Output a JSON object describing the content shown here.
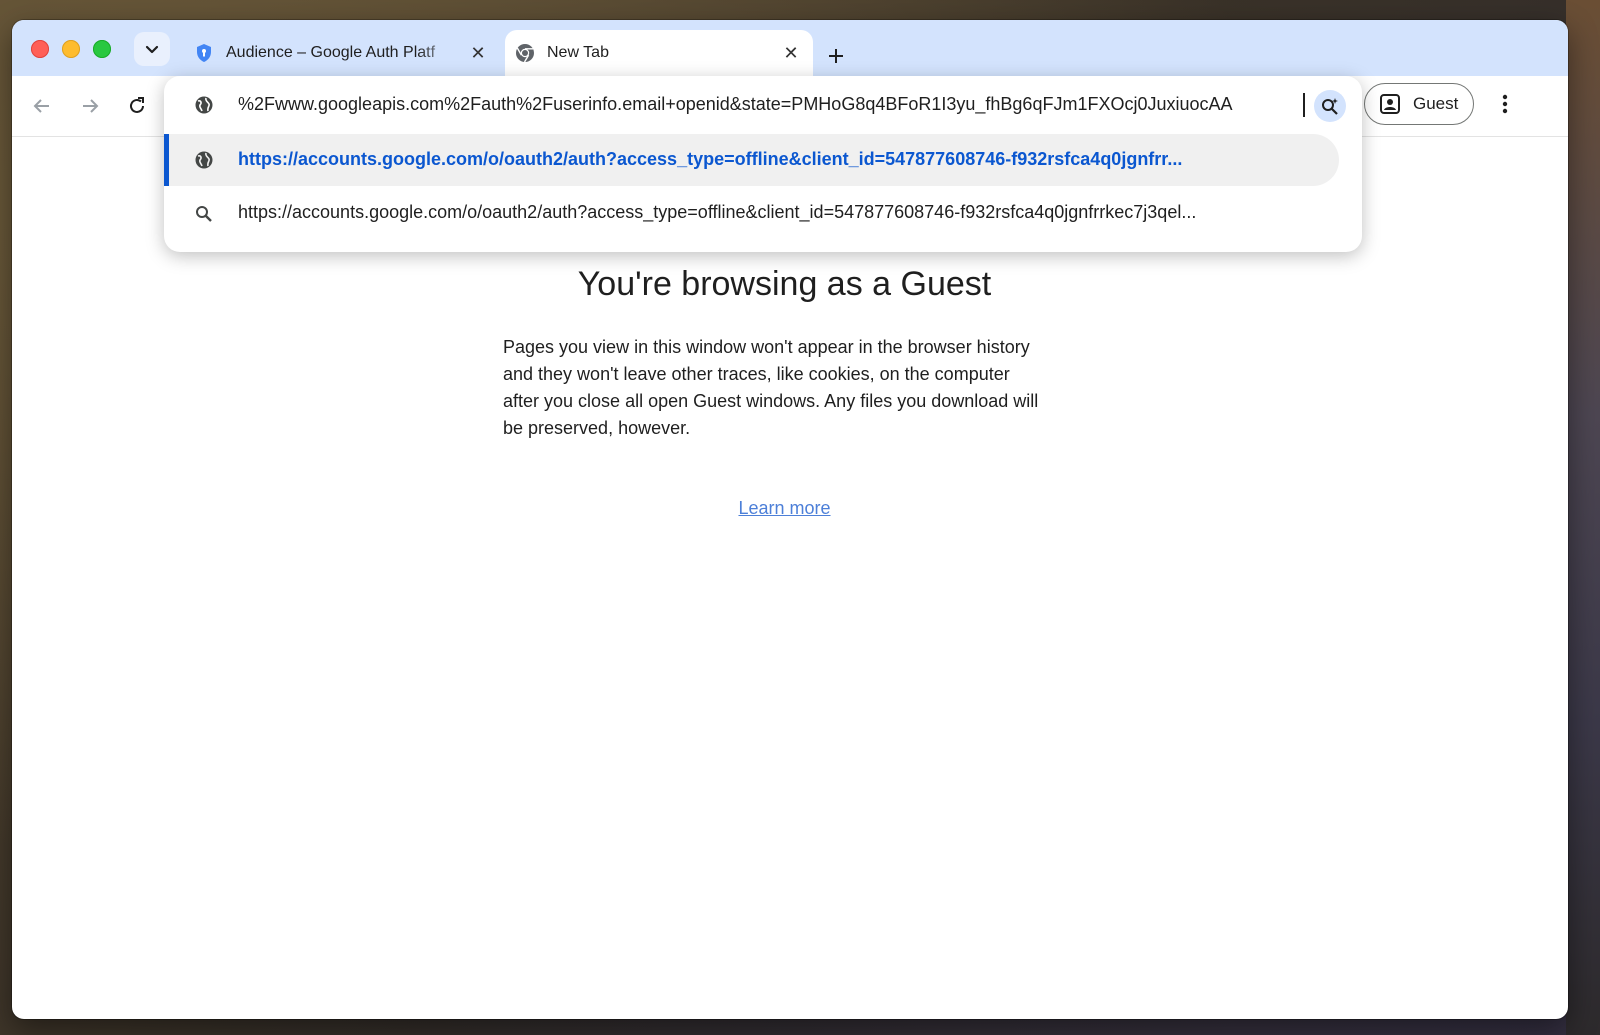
{
  "browser": {
    "tabs": [
      {
        "label": "Audience – Google Auth Platf",
        "active": false,
        "icon": "shield-icon"
      },
      {
        "label": "New Tab",
        "active": true,
        "icon": "chrome-icon"
      }
    ],
    "profile_button_label": "Guest"
  },
  "omnibox": {
    "input_value": "%2Fwww.googleapis.com%2Fauth%2Fuserinfo.email+openid&state=PMHoG8q4BFoR1I3yu_fhBg6qFJm1FXOcj0JuxiuocAA",
    "suggestions": [
      {
        "text": "https://accounts.google.com/o/oauth2/auth?access_type=offline&client_id=547877608746-f932rsfca4q0jgnfrr...",
        "type": "url",
        "icon": "globe-icon",
        "selected": true
      },
      {
        "text": "https://accounts.google.com/o/oauth2/auth?access_type=offline&client_id=547877608746-f932rsfca4q0jgnfrrkec7j3qel...",
        "type": "search",
        "icon": "search-icon",
        "selected": false
      }
    ]
  },
  "page": {
    "heading": "You're browsing as a Guest",
    "body": "Pages you view in this window won't appear in the browser history and they won't leave other traces, like cookies, on the computer after you close all open Guest windows. Any files you download will be preserved, however.",
    "learn_more": "Learn more"
  },
  "colors": {
    "tabstrip": "#d3e3fd",
    "accent": "#0b57d0",
    "link": "#4c7fd8"
  }
}
